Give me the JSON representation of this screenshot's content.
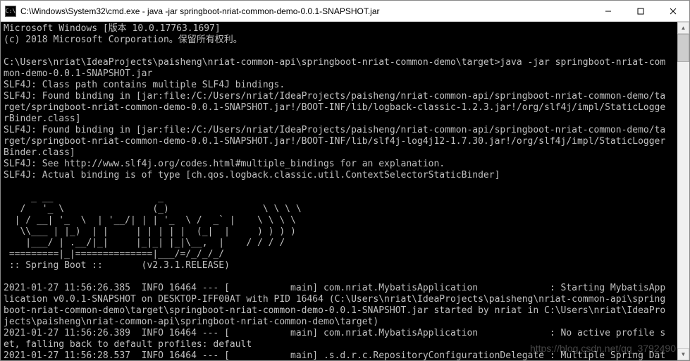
{
  "window": {
    "icon_label": "C:\\",
    "title": "C:\\Windows\\System32\\cmd.exe - java  -jar springboot-nriat-common-demo-0.0.1-SNAPSHOT.jar"
  },
  "terminal": {
    "lines": [
      "Microsoft Windows [版本 10.0.17763.1697]",
      "(c) 2018 Microsoft Corporation。保留所有权利。",
      "",
      "C:\\Users\\nriat\\IdeaProjects\\paisheng\\nriat-common-api\\springboot-nriat-common-demo\\target>java -jar springboot-nriat-com",
      "mon-demo-0.0.1-SNAPSHOT.jar",
      "SLF4J: Class path contains multiple SLF4J bindings.",
      "SLF4J: Found binding in [jar:file:/C:/Users/nriat/IdeaProjects/paisheng/nriat-common-api/springboot-nriat-common-demo/ta",
      "rget/springboot-nriat-common-demo-0.0.1-SNAPSHOT.jar!/BOOT-INF/lib/logback-classic-1.2.3.jar!/org/slf4j/impl/StaticLogge",
      "rBinder.class]",
      "SLF4J: Found binding in [jar:file:/C:/Users/nriat/IdeaProjects/paisheng/nriat-common-api/springboot-nriat-common-demo/ta",
      "rget/springboot-nriat-common-demo-0.0.1-SNAPSHOT.jar!/BOOT-INF/lib/slf4j-log4j12-1.7.30.jar!/org/slf4j/impl/StaticLogger",
      "Binder.class]",
      "SLF4J: See http://www.slf4j.org/codes.html#multiple_bindings for an explanation.",
      "SLF4J: Actual binding is of type [ch.qos.logback.classic.util.ContextSelectorStaticBinder]"
    ],
    "ascii_art": [
      "     _ __                   _                      ",
      "   /   '_ \\                (_)                 \\ \\ \\ \\",
      "  | / __| '_  \\  | '__/| | | '_  \\ /  _` |    \\ \\ \\ \\",
      "   \\\\___ | |_)  | |     | | | | |  (_|  |     ) ) ) )",
      "    |___/ | .__/|_|     |_|_| |_|\\__,  |    / / / /",
      " =========|_|==============|___/=/_/_/_/"
    ],
    "spring_line": " :: Spring Boot ::       (v2.3.1.RELEASE)",
    "log_lines": [
      "2021-01-27 11:56:26.385  INFO 16464 --- [           main] com.nriat.MybatisApplication             : Starting MybatisApp",
      "lication v0.0.1-SNAPSHOT on DESKTOP-IFF00AT with PID 16464 (C:\\Users\\nriat\\IdeaProjects\\paisheng\\nriat-common-api\\spring",
      "boot-nriat-common-demo\\target\\springboot-nriat-common-demo-0.0.1-SNAPSHOT.jar started by nriat in C:\\Users\\nriat\\IdeaPro",
      "jects\\paisheng\\nriat-common-api\\springboot-nriat-common-demo\\target)",
      "2021-01-27 11:56:26.389  INFO 16464 --- [           main] com.nriat.MybatisApplication             : No active profile s",
      "et, falling back to default profiles: default",
      "2021-01-27 11:56:28.537  INFO 16464 --- [           main] .s.d.r.c.RepositoryConfigurationDelegate : Multiple Spring Dat"
    ]
  },
  "watermark": "https://blog.csdn.net/qq_3792490"
}
